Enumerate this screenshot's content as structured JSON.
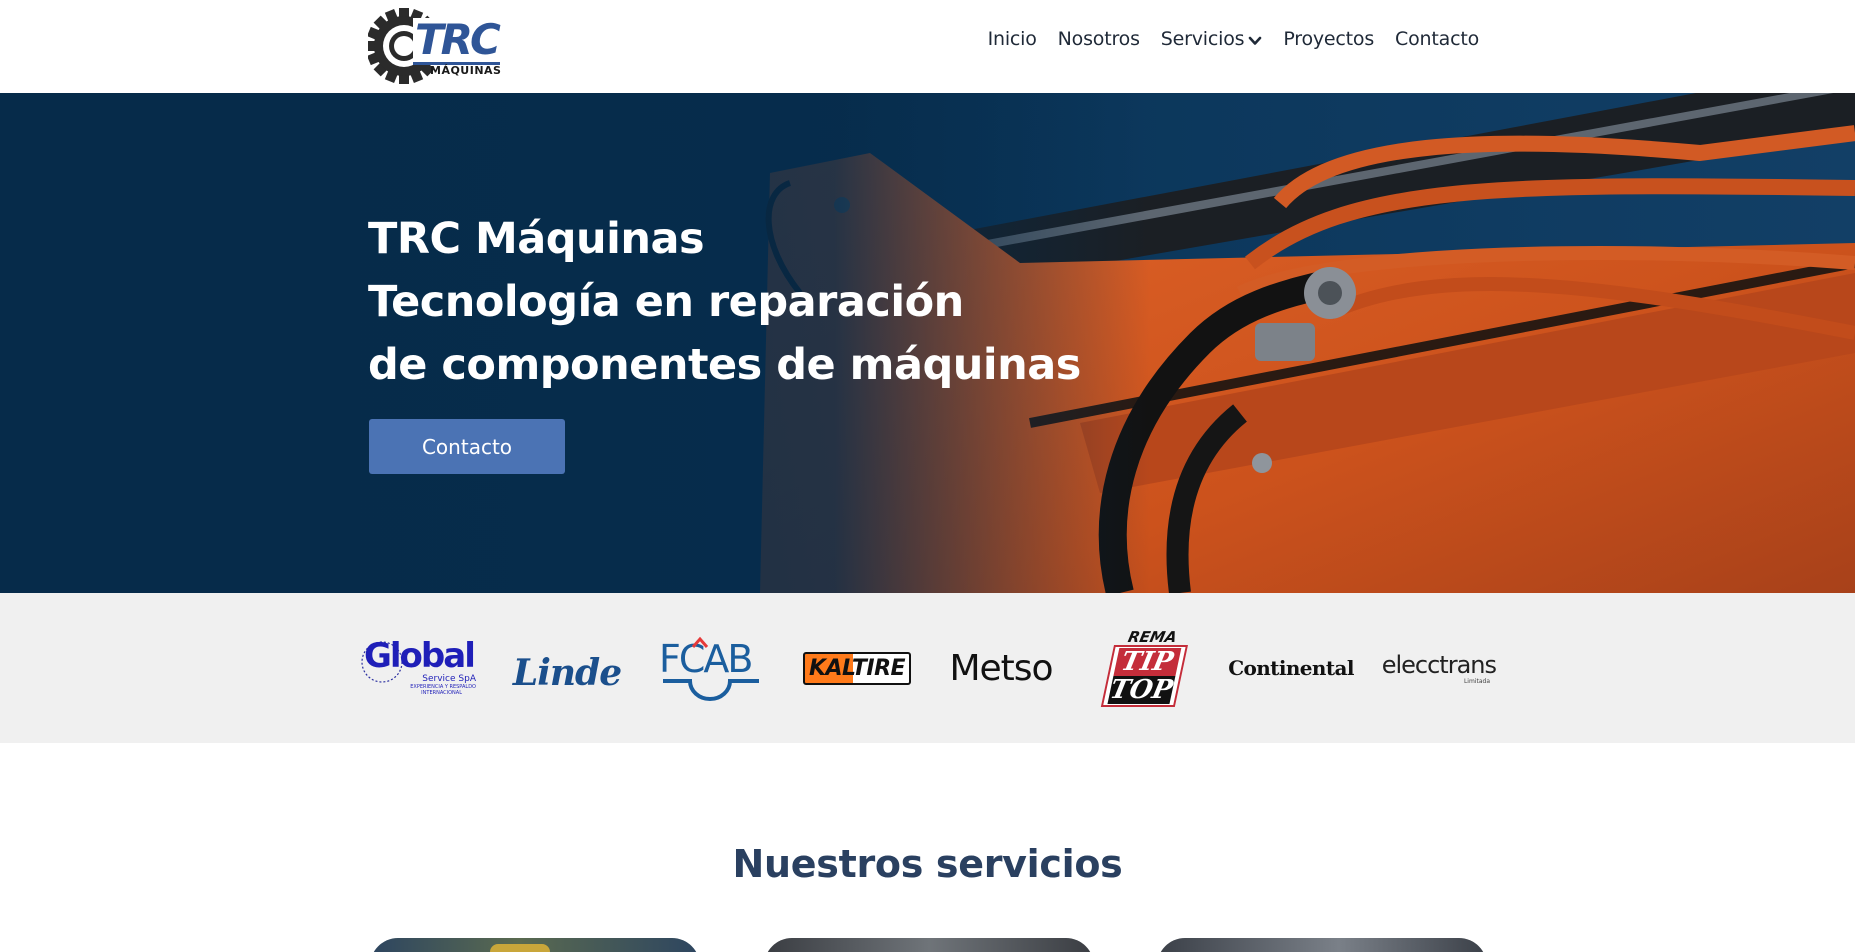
{
  "logo": {
    "main": "TRC",
    "sub": "MÁQUINAS"
  },
  "nav": [
    {
      "label": "Inicio"
    },
    {
      "label": "Nosotros"
    },
    {
      "label": "Servicios",
      "has_dropdown": true
    },
    {
      "label": "Proyectos"
    },
    {
      "label": "Contacto"
    }
  ],
  "hero": {
    "lines": [
      "TRC Máquinas",
      "Tecnología en reparación",
      "de componentes de máquinas"
    ],
    "cta": "Contacto"
  },
  "clients": [
    {
      "name": "Global",
      "sub": "Service SpA",
      "tag1": "EXPERIENCIA Y RESPALDO",
      "tag2": "INTERNACIONAL"
    },
    {
      "name": "Linde"
    },
    {
      "name": "FCAB"
    },
    {
      "name": "KALTIRE"
    },
    {
      "name": "Metso"
    },
    {
      "name": "REMA",
      "line2": "TIP",
      "line3": "TOP"
    },
    {
      "name": "Continental"
    },
    {
      "name": "elecctrans",
      "sub": "Limitada"
    }
  ],
  "services": {
    "title": "Nuestros servicios"
  },
  "colors": {
    "accent": "#4b73b4",
    "navy": "#062b4a",
    "heading": "#2a4060",
    "orange": "#d2561f",
    "strip": "#f0f0f0"
  }
}
